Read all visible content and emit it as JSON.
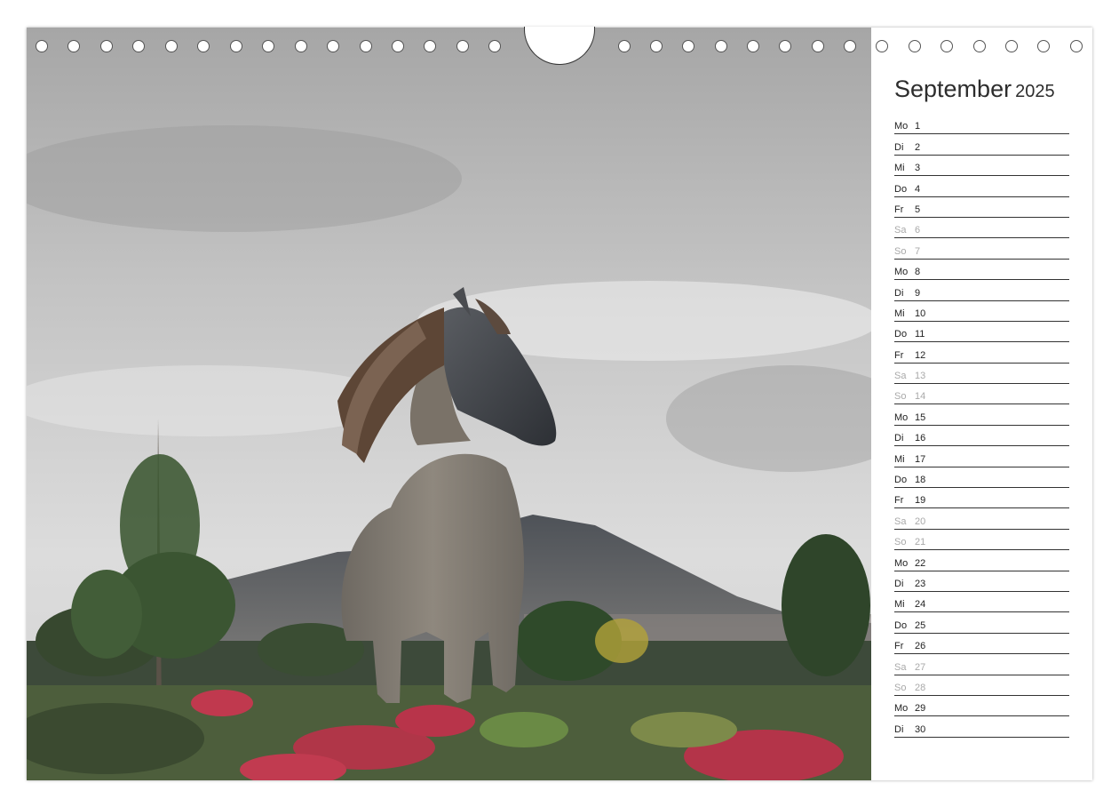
{
  "calendar": {
    "month": "September",
    "year": "2025",
    "days": [
      {
        "weekday": "Mo",
        "date": "1",
        "weekend": false
      },
      {
        "weekday": "Di",
        "date": "2",
        "weekend": false
      },
      {
        "weekday": "Mi",
        "date": "3",
        "weekend": false
      },
      {
        "weekday": "Do",
        "date": "4",
        "weekend": false
      },
      {
        "weekday": "Fr",
        "date": "5",
        "weekend": false
      },
      {
        "weekday": "Sa",
        "date": "6",
        "weekend": true
      },
      {
        "weekday": "So",
        "date": "7",
        "weekend": true
      },
      {
        "weekday": "Mo",
        "date": "8",
        "weekend": false
      },
      {
        "weekday": "Di",
        "date": "9",
        "weekend": false
      },
      {
        "weekday": "Mi",
        "date": "10",
        "weekend": false
      },
      {
        "weekday": "Do",
        "date": "11",
        "weekend": false
      },
      {
        "weekday": "Fr",
        "date": "12",
        "weekend": false
      },
      {
        "weekday": "Sa",
        "date": "13",
        "weekend": true
      },
      {
        "weekday": "So",
        "date": "14",
        "weekend": true
      },
      {
        "weekday": "Mo",
        "date": "15",
        "weekend": false
      },
      {
        "weekday": "Di",
        "date": "16",
        "weekend": false
      },
      {
        "weekday": "Mi",
        "date": "17",
        "weekend": false
      },
      {
        "weekday": "Do",
        "date": "18",
        "weekend": false
      },
      {
        "weekday": "Fr",
        "date": "19",
        "weekend": false
      },
      {
        "weekday": "Sa",
        "date": "20",
        "weekend": true
      },
      {
        "weekday": "So",
        "date": "21",
        "weekend": true
      },
      {
        "weekday": "Mo",
        "date": "22",
        "weekend": false
      },
      {
        "weekday": "Di",
        "date": "23",
        "weekend": false
      },
      {
        "weekday": "Mi",
        "date": "24",
        "weekend": false
      },
      {
        "weekday": "Do",
        "date": "25",
        "weekend": false
      },
      {
        "weekday": "Fr",
        "date": "26",
        "weekend": false
      },
      {
        "weekday": "Sa",
        "date": "27",
        "weekend": true
      },
      {
        "weekday": "So",
        "date": "28",
        "weekend": true
      },
      {
        "weekday": "Mo",
        "date": "29",
        "weekend": false
      },
      {
        "weekday": "Di",
        "date": "30",
        "weekend": false
      }
    ]
  },
  "colors": {
    "text": "#222222",
    "weekend_text": "#a9a9a9",
    "rule": "#333333"
  }
}
